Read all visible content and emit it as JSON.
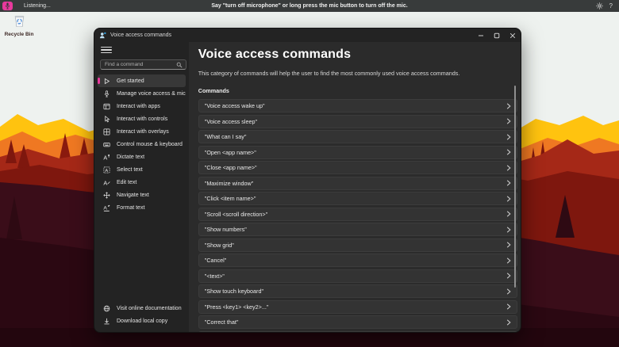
{
  "voice_bar": {
    "status": "Listening...",
    "instruction": "Say \"turn off microphone\" or long press the mic button to turn off the mic.",
    "help_glyph": "?"
  },
  "desktop": {
    "recycle_bin_label": "Recycle Bin"
  },
  "window": {
    "title": "Voice access commands",
    "sidebar": {
      "search_placeholder": "Find a command",
      "items": [
        {
          "label": "Get started"
        },
        {
          "label": "Manage voice access & mic"
        },
        {
          "label": "Interact with apps"
        },
        {
          "label": "Interact with controls"
        },
        {
          "label": "Interact with overlays"
        },
        {
          "label": "Control mouse & keyboard"
        },
        {
          "label": "Dictate text"
        },
        {
          "label": "Select text"
        },
        {
          "label": "Edit text"
        },
        {
          "label": "Navigate text"
        },
        {
          "label": "Format text"
        }
      ],
      "footer": [
        {
          "label": "Visit online documentation"
        },
        {
          "label": "Download local copy"
        }
      ]
    },
    "main": {
      "heading": "Voice access commands",
      "description": "This category of commands will help the user to find the most commonly used voice access commands.",
      "section_label": "Commands",
      "commands": [
        "\"Voice access wake up\"",
        "\"Voice access sleep\"",
        "\"What can I say\"",
        "\"Open <app name>\"",
        "\"Close <app name>\"",
        "\"Maximize window\"",
        "\"Click <item name>\"",
        "\"Scroll <scroll direction>\"",
        "\"Show numbers\"",
        "\"Show grid\"",
        "\"Cancel\"",
        "\"<text>\"",
        "\"Show touch keyboard\"",
        "\"Press <key1> <key2>...\"",
        "\"Correct that\""
      ]
    }
  },
  "colors": {
    "accent_pink": "#e8399c",
    "topbar": "#383b3b",
    "window_bg": "#232323",
    "main_bg": "#2b2b2b",
    "row_bg": "#333333"
  }
}
